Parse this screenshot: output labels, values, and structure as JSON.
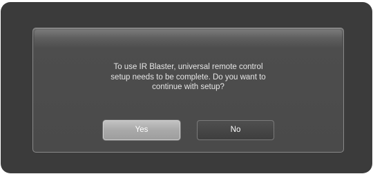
{
  "dialog": {
    "message_lines": [
      "To use IR Blaster, universal remote control",
      "setup needs to be complete. Do you want to",
      "continue with setup?"
    ],
    "buttons": {
      "yes_label": "Yes",
      "no_label": "No"
    },
    "focused_button": "Yes"
  },
  "colors": {
    "screen_background": "#3b3b3b",
    "dialog_background": "#4a4a4a",
    "focused_button": "#a9a9a9"
  }
}
